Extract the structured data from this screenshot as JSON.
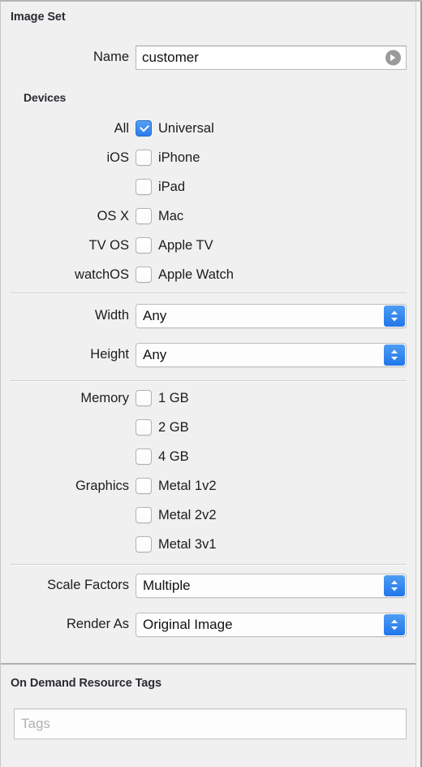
{
  "window": {
    "accent_blue": "#2b7ced",
    "background": "#f0f0f0"
  },
  "image_set": {
    "title": "Image Set",
    "name_row": {
      "label": "Name",
      "value": "customer",
      "reveal_icon": "arrow-right-circle-icon"
    },
    "devices": {
      "group_title": "Devices",
      "rows": [
        {
          "label": "All",
          "caption": "Universal",
          "checked": true
        },
        {
          "label": "iOS",
          "caption": "iPhone",
          "checked": false
        },
        {
          "label": "",
          "caption": "iPad",
          "checked": false
        },
        {
          "label": "OS X",
          "caption": "Mac",
          "checked": false
        },
        {
          "label": "TV OS",
          "caption": "Apple TV",
          "checked": false
        },
        {
          "label": "watchOS",
          "caption": "Apple Watch",
          "checked": false
        }
      ]
    },
    "size": {
      "rows": [
        {
          "label": "Width",
          "value": "Any"
        },
        {
          "label": "Height",
          "value": "Any"
        }
      ]
    },
    "hardware": {
      "rows": [
        {
          "label": "Memory",
          "caption": "1 GB",
          "checked": false
        },
        {
          "label": "",
          "caption": "2 GB",
          "checked": false
        },
        {
          "label": "",
          "caption": "4 GB",
          "checked": false
        },
        {
          "label": "Graphics",
          "caption": "Metal 1v2",
          "checked": false
        },
        {
          "label": "",
          "caption": "Metal 2v2",
          "checked": false
        },
        {
          "label": "",
          "caption": "Metal 3v1",
          "checked": false
        }
      ]
    },
    "rendering": {
      "rows": [
        {
          "label": "Scale Factors",
          "value": "Multiple"
        },
        {
          "label": "Render As",
          "value": "Original Image"
        }
      ]
    }
  },
  "on_demand_resource_tags": {
    "title": "On Demand Resource Tags",
    "tags_input": {
      "value": "",
      "placeholder": "Tags"
    }
  }
}
